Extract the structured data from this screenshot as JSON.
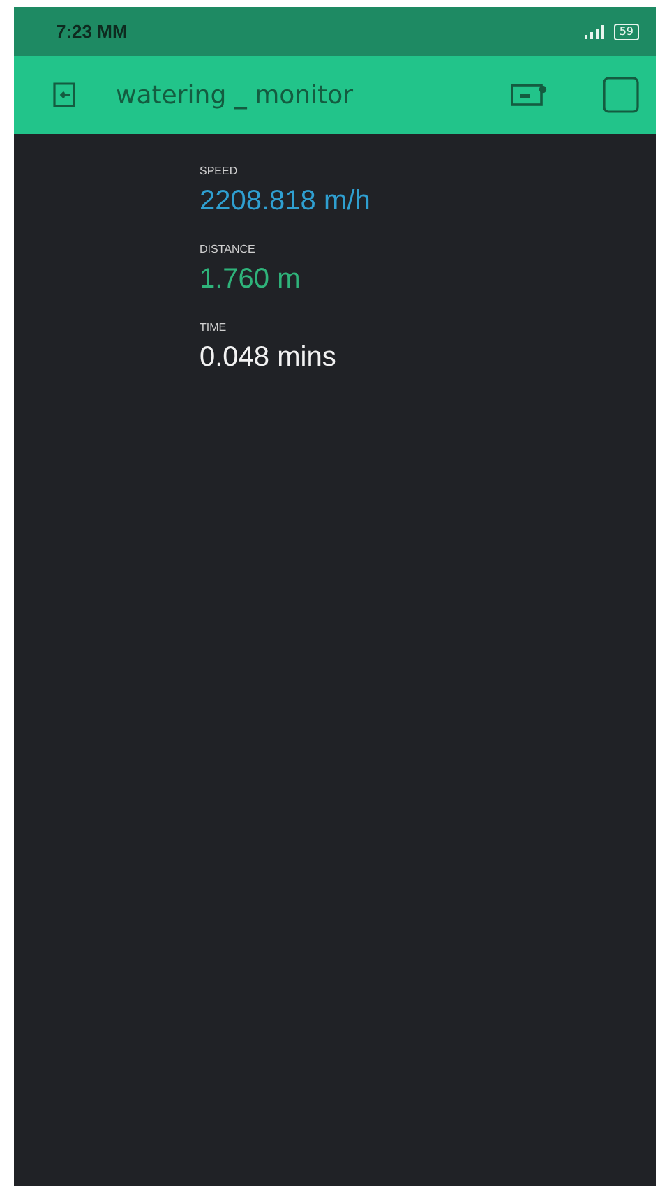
{
  "status_bar": {
    "time": "7:23 MM",
    "battery": "59"
  },
  "app_bar": {
    "title": "watering _ monitor"
  },
  "displays": [
    {
      "label": "SPEED",
      "value": "2208.818 m/h",
      "color": "#2f9fd0"
    },
    {
      "label": "DISTANCE",
      "value": "1.760 m",
      "color": "#2fb37a"
    },
    {
      "label": "TIME",
      "value": "0.048 mins",
      "color": "#f2f2f2"
    }
  ]
}
